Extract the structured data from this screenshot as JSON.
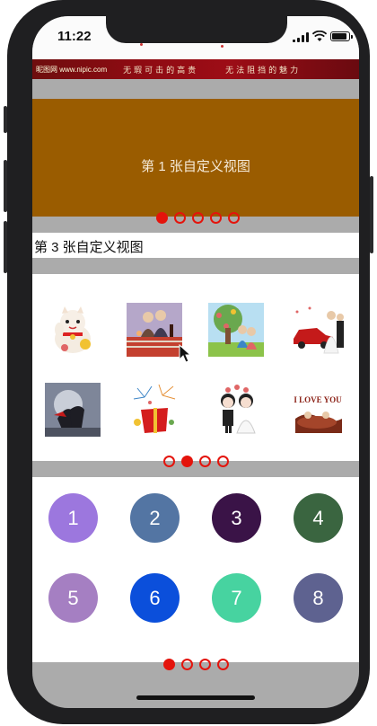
{
  "status_bar": {
    "time": "11:22"
  },
  "top_banner": {
    "logo": "昵图网 www.nipic.com",
    "slogan_left": "无瑕可击的高贵",
    "slogan_right": "无法阻挡的魅力"
  },
  "section1": {
    "caption": "第 1 张自定义视图",
    "dots_total": 5,
    "active_index": 0
  },
  "section2": {
    "caption": "第 3 张自定义视图"
  },
  "section3": {
    "thumbnails": [
      {
        "name": "lucky-cat-image"
      },
      {
        "name": "couple-dinner-image"
      },
      {
        "name": "couple-tree-image"
      },
      {
        "name": "wedding-car-image"
      },
      {
        "name": "silhouette-kiss-image"
      },
      {
        "name": "gift-fireworks-image"
      },
      {
        "name": "cartoon-wedding-image"
      },
      {
        "name": "i-love-you-image",
        "text": "I LOVE YOU"
      }
    ],
    "dots_total": 4,
    "active_index": 1
  },
  "section4": {
    "buttons": [
      {
        "label": "1",
        "color": "#9c77de"
      },
      {
        "label": "2",
        "color": "#5375a3"
      },
      {
        "label": "3",
        "color": "#3a1347"
      },
      {
        "label": "4",
        "color": "#3a6540"
      },
      {
        "label": "5",
        "color": "#a57fc2"
      },
      {
        "label": "6",
        "color": "#0b4fdb"
      },
      {
        "label": "7",
        "color": "#47d3a0"
      },
      {
        "label": "8",
        "color": "#5e6290"
      }
    ],
    "dots_total": 4,
    "active_index": 0
  },
  "accent_color": "#e4140c"
}
